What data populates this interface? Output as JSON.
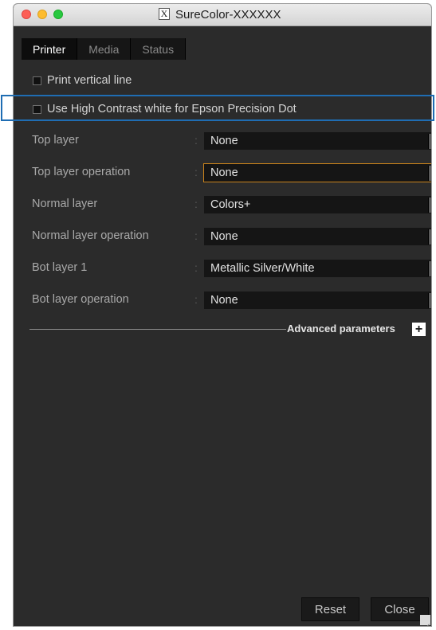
{
  "window": {
    "app_icon": "X",
    "title": "SureColor-XXXXXX"
  },
  "tabs": [
    {
      "label": "Printer",
      "active": true
    },
    {
      "label": "Media",
      "active": false
    },
    {
      "label": "Status",
      "active": false
    }
  ],
  "checkboxes": {
    "print_vertical_line": {
      "label": "Print vertical line",
      "checked": false
    },
    "high_contrast_white": {
      "label": "Use High Contrast white for Epson Precision Dot",
      "checked": false
    }
  },
  "params": [
    {
      "label": "Top layer",
      "value": "None"
    },
    {
      "label": "Top layer operation",
      "value": "None"
    },
    {
      "label": "Normal layer",
      "value": "Colors+"
    },
    {
      "label": "Normal layer operation",
      "value": "None"
    },
    {
      "label": "Bot layer 1",
      "value": "Metallic Silver/White"
    },
    {
      "label": "Bot layer operation",
      "value": "None"
    }
  ],
  "colon": ":",
  "advanced": {
    "label": "Advanced parameters",
    "toggle": "+"
  },
  "buttons": {
    "reset": "Reset",
    "close": "Close"
  },
  "colors": {
    "highlight": "#1f6db3",
    "focus": "#c9831c",
    "panel": "#2b2b2b"
  }
}
